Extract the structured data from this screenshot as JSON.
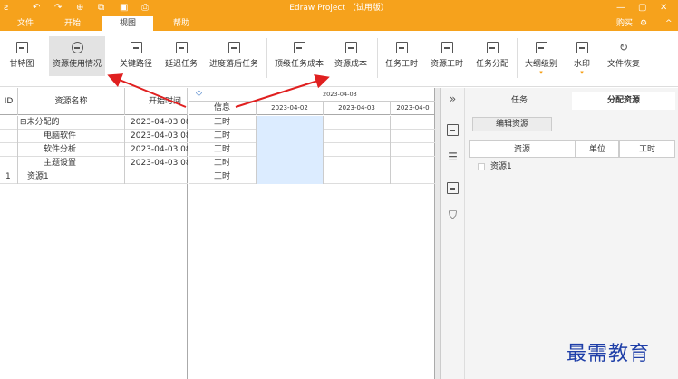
{
  "window": {
    "title": "Edraw Project （试用版）",
    "controls": [
      "—",
      "▢",
      "✕"
    ]
  },
  "quick_access": [
    "↶",
    "↷",
    "⊕",
    "⧉",
    "▣",
    "⎙"
  ],
  "menu": {
    "tabs": [
      "文件",
      "开始",
      "视图",
      "帮助"
    ],
    "active_tab": 2,
    "buy_label": "购买",
    "settings_label": "⚙",
    "collapse_label": "^"
  },
  "ribbon": {
    "buttons": [
      {
        "label": "甘特图",
        "icon": "gantt-icon"
      },
      {
        "label": "资源使用情况",
        "icon": "globe-icon",
        "active": true
      },
      {
        "label": "关键路径",
        "icon": "critical-path-icon"
      },
      {
        "label": "延迟任务",
        "icon": "delay-task-icon"
      },
      {
        "label": "进度落后任务",
        "icon": "behind-task-icon"
      },
      {
        "label": "顶级任务成本",
        "icon": "top-cost-icon"
      },
      {
        "label": "资源成本",
        "icon": "resource-cost-icon"
      },
      {
        "label": "任务工时",
        "icon": "task-hours-icon"
      },
      {
        "label": "资源工时",
        "icon": "resource-hours-icon"
      },
      {
        "label": "任务分配",
        "icon": "task-assign-icon"
      },
      {
        "label": "大纲级别",
        "icon": "outline-level-icon",
        "dropdown": "▾"
      },
      {
        "label": "水印",
        "icon": "watermark-icon",
        "dropdown": "▾"
      },
      {
        "label": "文件恢复",
        "icon": "file-restore-icon"
      }
    ]
  },
  "left_grid": {
    "headers": [
      "ID",
      "资源名称",
      "开始时间"
    ],
    "rows": [
      {
        "id": "",
        "name": "⊟未分配的",
        "start": "2023-04-03 08"
      },
      {
        "id": "",
        "name": "电脑软件",
        "start": "2023-04-03 08"
      },
      {
        "id": "",
        "name": "软件分析",
        "start": "2023-04-03 08"
      },
      {
        "id": "",
        "name": "主题设置",
        "start": "2023-04-03 08"
      },
      {
        "id": "1",
        "name": "资源1",
        "start": ""
      }
    ]
  },
  "timeline": {
    "top_label": "2023-04-03",
    "info_header": "信息",
    "dates": [
      "2023-04-02",
      "2023-04-03",
      "2023-04-0"
    ],
    "row_labels": [
      "工时",
      "工时",
      "工时",
      "工时",
      "工时"
    ]
  },
  "right_panel": {
    "tabs": [
      "任务",
      "分配资源"
    ],
    "active_tab": 1,
    "edit_button": "编辑资源",
    "headers": [
      "资源",
      "单位",
      "工时"
    ],
    "items": [
      "资源1"
    ]
  },
  "watermark_text": "最需教育"
}
